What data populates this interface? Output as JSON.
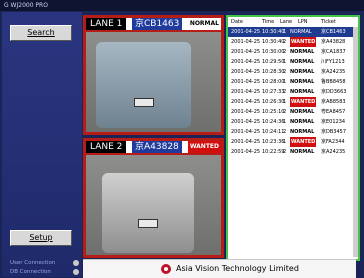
{
  "window": {
    "title": "G WJ2000 PRO"
  },
  "sidebar": {
    "search_label": "Search",
    "setup_label": "Setup",
    "status_user": "User Connection",
    "status_db": "DB Connection"
  },
  "lanes": [
    {
      "label": "LANE 1",
      "lpn": "京CB1463",
      "status": "NORMAL",
      "status_type": "normal"
    },
    {
      "label": "LANE 2",
      "lpn": "京A43828",
      "status": "WANTED",
      "status_type": "wanted"
    }
  ],
  "table": {
    "headers": [
      "Date",
      "Time",
      "Lane",
      "LPN",
      "Ticket"
    ],
    "rows": [
      {
        "date": "2001-04-25",
        "time": "10:30:40",
        "lane": "1",
        "lpn": "NORMAL",
        "ticket": "京CB1463",
        "sel": true
      },
      {
        "date": "2001-04-25",
        "time": "10:30:40",
        "lane": "2",
        "lpn": "WANTED",
        "ticket": "京A43828"
      },
      {
        "date": "2001-04-25",
        "time": "10:30:00",
        "lane": "2",
        "lpn": "NORMAL",
        "ticket": "京CA1837"
      },
      {
        "date": "2001-04-25",
        "time": "10:29:50",
        "lane": "1",
        "lpn": "NORMAL",
        "ticket": "川FY1213"
      },
      {
        "date": "2001-04-25",
        "time": "10:28:30",
        "lane": "2",
        "lpn": "NORMAL",
        "ticket": "京A24235"
      },
      {
        "date": "2001-04-25",
        "time": "10:28:00",
        "lane": "1",
        "lpn": "NORMAL",
        "ticket": "鲁BB8458"
      },
      {
        "date": "2001-04-25",
        "time": "10:27:33",
        "lane": "2",
        "lpn": "NORMAL",
        "ticket": "京DD3663"
      },
      {
        "date": "2001-04-25",
        "time": "10:26:30",
        "lane": "1",
        "lpn": "WANTED",
        "ticket": "京AB8583"
      },
      {
        "date": "2001-04-25",
        "time": "10:25:10",
        "lane": "2",
        "lpn": "NORMAL",
        "ticket": "粤EA8457"
      },
      {
        "date": "2001-04-25",
        "time": "10:24:36",
        "lane": "1",
        "lpn": "NORMAL",
        "ticket": "京E01234"
      },
      {
        "date": "2001-04-25",
        "time": "10:24:11",
        "lane": "2",
        "lpn": "NORMAL",
        "ticket": "京DB3457"
      },
      {
        "date": "2001-04-25",
        "time": "10:23:36",
        "lane": "1",
        "lpn": "WANTED",
        "ticket": "京FA2344"
      },
      {
        "date": "2001-04-25",
        "time": "10:22:59",
        "lane": "2",
        "lpn": "NORMAL",
        "ticket": "京A24235"
      }
    ]
  },
  "footer": {
    "company": "Asia Vision Technology Limited"
  },
  "colors": {
    "lane_border": "#b51d16",
    "lpn_bg": "#1f3b9d",
    "wanted": "#d10f0f",
    "table_border": "#45c44a"
  }
}
